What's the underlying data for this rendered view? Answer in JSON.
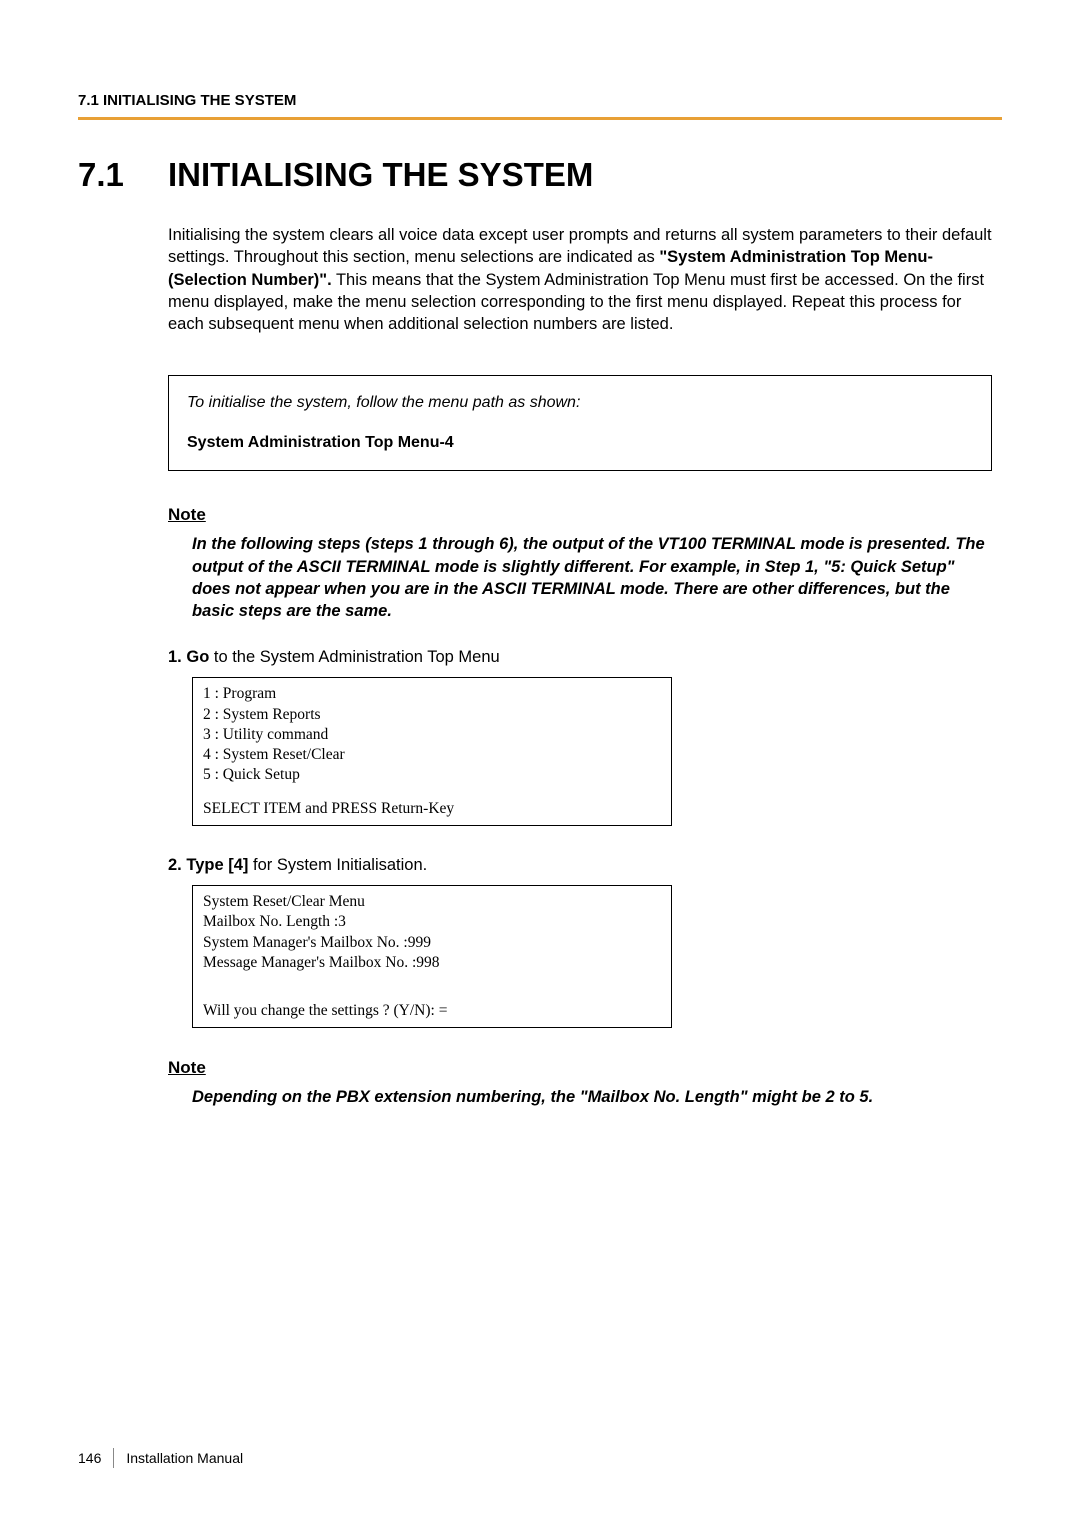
{
  "header": "7.1 INITIALISING THE SYSTEM",
  "title_num": "7.1",
  "title_text": "INITIALISING THE SYSTEM",
  "intro_before": "Initialising the system clears all voice data except user prompts and returns all system parameters to their default settings. Throughout this section, menu selections are indicated as ",
  "intro_bold": "\"System Administration Top Menu-(Selection Number)\".",
  "intro_after": " This means that the System Administration Top Menu must first be accessed. On the first menu displayed, make the menu selection corresponding to the first menu displayed. Repeat this process for each subsequent menu when additional selection numbers are listed.",
  "box": {
    "line1": "To initialise the system, follow the menu path as shown:",
    "line2": "System Administration Top Menu-4"
  },
  "note1": {
    "heading": "Note",
    "body": "In the following steps (steps 1 through 6), the output of the VT100 TERMINAL mode is presented. The output of the ASCII TERMINAL mode is slightly different. For example, in Step 1, \"5: Quick Setup\" does not appear when you are in the ASCII TERMINAL mode. There are other differences, but the basic steps are the same."
  },
  "step1": {
    "num": "1.",
    "bold": "Go",
    "rest": " to the System Administration Top Menu"
  },
  "terminal1": {
    "l1": "1 : Program",
    "l2": "2 : System Reports",
    "l3": "3 : Utility command",
    "l4": "4 : System Reset/Clear",
    "l5": "5 : Quick Setup",
    "l6": "SELECT ITEM and PRESS Return-Key"
  },
  "step2": {
    "num": "2.",
    "bold": "Type [4]",
    "rest": " for System Initialisation."
  },
  "terminal2": {
    "l1": "System Reset/Clear Menu",
    "l2": "Mailbox No. Length  :3",
    "l3": "System Manager's Mailbox No.   :999",
    "l4": "Message Manager's Mailbox No. :998",
    "l5": "Will you change the settings ? (Y/N): ="
  },
  "note2": {
    "heading": "Note",
    "body": "Depending on the PBX extension numbering, the \"Mailbox No. Length\" might be 2 to 5."
  },
  "footer": {
    "page": "146",
    "doc": "Installation Manual"
  }
}
